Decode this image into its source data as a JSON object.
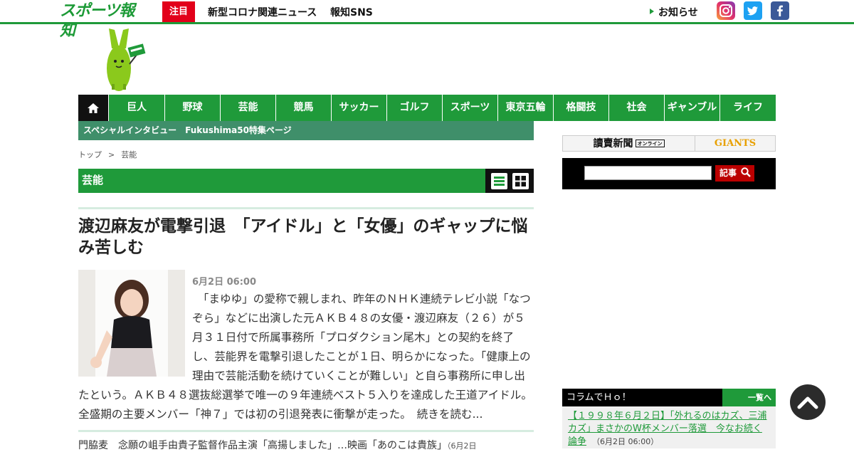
{
  "header": {
    "logo_text": "スポーツ報知",
    "attention_label": "注目",
    "links": [
      "新型コロナ関連ニュース",
      "報知SNS"
    ],
    "notice_label": "お知らせ"
  },
  "nav": {
    "items": [
      "巨人",
      "野球",
      "芸能",
      "競馬",
      "サッカー",
      "ゴルフ",
      "スポーツ",
      "東京五輪",
      "格闘技",
      "社会",
      "ギャンブル",
      "ライフ"
    ]
  },
  "subbar": {
    "text": "スペシャルインタビュー　Fukushima50特集ページ"
  },
  "breadcrumb": {
    "top": "トップ",
    "sep": ">",
    "current": "芸能"
  },
  "category": {
    "title": "芸能"
  },
  "article": {
    "headline": "渡辺麻友が電撃引退　「アイドル」と「女優」のギャップに悩み苦しむ",
    "date": "6月2日 06:00",
    "body": "　「まゆゆ」の愛称で親しまれ、昨年のＮＨＫ連続テレビ小説「なつぞら」などに出演した元ＡＫＢ４８の女優・渡辺麻友（２６）が５月３１日付で所属事務所「プロダクション尾木」との契約を終了し、芸能界を電撃引退したことが１日、明らかになった。「健康上の理由で芸能活動を続けていくことが難しい」と自ら事務所に申し出たという。ＡＫＢ４８選抜総選挙で唯一の９年連続ベスト５入りを達成した王道アイドル。全盛期の主要メンバー「神７」では初の引退発表に衝撃が走った。",
    "more_label": "続きを読む..."
  },
  "related": {
    "text": "門脇麦　念願の岨手由貴子監督作品主演「高揚しました」…映画「あのこは貴族」",
    "date": "（6月2日"
  },
  "sidebar": {
    "banner_left": "讀賣新聞",
    "banner_left_badge": "オンライン",
    "banner_right": "GIANTS",
    "search_value": "",
    "search_button": "記事",
    "column_title": "コラムでＨｏ！",
    "column_more": "一覧へ",
    "column_link": "【１９９８年６月２日】「外れるのはカズ、三浦カズ」まさかのW杯メンバー落選　今なお続く論争",
    "column_date": "（6月2日 06:00）"
  },
  "colors": {
    "brand_green": "#1f9a3a",
    "attention_red": "#e2001a",
    "subbar_green": "#3f8f6a"
  }
}
